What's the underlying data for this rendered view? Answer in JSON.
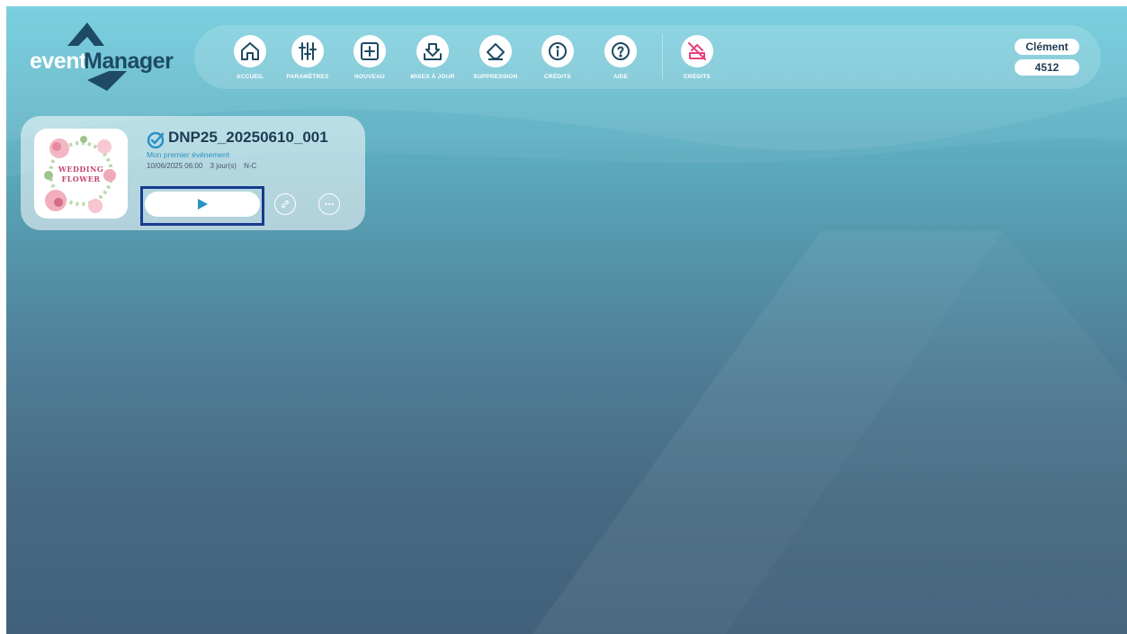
{
  "app": {
    "logo_part1": "event",
    "logo_part2": "Manager"
  },
  "toolbar": {
    "items": [
      {
        "label": "ACCUEIL",
        "icon": "home-icon"
      },
      {
        "label": "PARAMÈTRES",
        "icon": "sliders-icon"
      },
      {
        "label": "NOUVEAU",
        "icon": "plus-square-icon"
      },
      {
        "label": "MISES À JOUR",
        "icon": "download-tray-icon"
      },
      {
        "label": "SUPPRESSION",
        "icon": "eraser-icon"
      },
      {
        "label": "CRÉDITS",
        "icon": "info-icon"
      },
      {
        "label": "AIDE",
        "icon": "help-icon"
      },
      {
        "label": "CRÉDITS",
        "icon": "credits-disabled-icon"
      }
    ],
    "colors": {
      "icon": "#1e4a63",
      "credits_icon": "#e8407f"
    }
  },
  "user": {
    "name": "Clément",
    "code": "4512"
  },
  "event": {
    "title": "DNP25_20250610_001",
    "subtitle": "Mon premier événement",
    "date": "10/06/2025 06:00",
    "duration": "3 jour(s)",
    "status": "N-C",
    "thumbnail_text_1": "WEDDING",
    "thumbnail_text_2": "FLOWER",
    "accent_color": "#2a93c4"
  }
}
